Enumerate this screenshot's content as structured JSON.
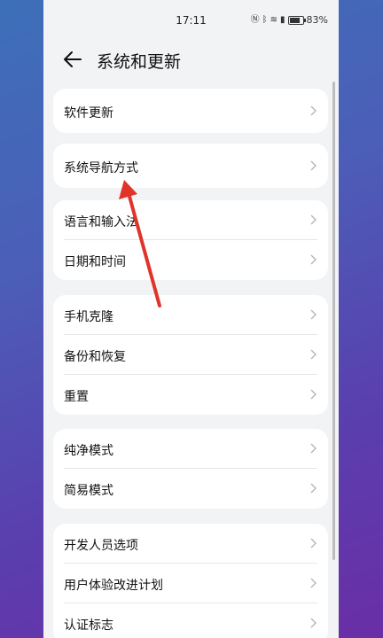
{
  "status": {
    "time": "17:11",
    "battery": "83%"
  },
  "header": {
    "title": "系统和更新"
  },
  "sections": [
    {
      "items": [
        {
          "label": "软件更新"
        }
      ]
    },
    {
      "items": [
        {
          "label": "系统导航方式"
        }
      ]
    },
    {
      "items": [
        {
          "label": "语言和输入法"
        },
        {
          "label": "日期和时间"
        }
      ]
    },
    {
      "items": [
        {
          "label": "手机克隆"
        },
        {
          "label": "备份和恢复"
        },
        {
          "label": "重置"
        }
      ]
    },
    {
      "items": [
        {
          "label": "纯净模式"
        },
        {
          "label": "简易模式"
        }
      ]
    },
    {
      "items": [
        {
          "label": "开发人员选项"
        },
        {
          "label": "用户体验改进计划"
        },
        {
          "label": "认证标志"
        }
      ]
    }
  ],
  "colors": {
    "annotation_arrow": "#e0342b"
  }
}
